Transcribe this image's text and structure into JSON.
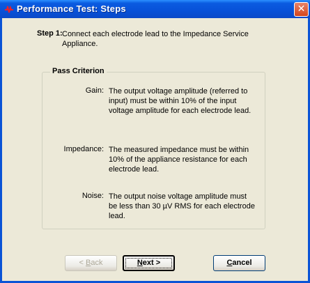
{
  "window": {
    "title": "Performance Test:  Steps"
  },
  "step": {
    "label": "Step 1:",
    "text": "Connect each electrode lead to the Impedance Service Appliance."
  },
  "pass_criterion": {
    "title": "Pass Criterion",
    "items": [
      {
        "label": "Gain:",
        "text": "The output voltage amplitude (referred to input) must be within 10% of the input voltage amplitude for each electrode lead."
      },
      {
        "label": "Impedance:",
        "text": "The measured impedance must be within 10% of the appliance resistance for each electrode lead."
      },
      {
        "label": "Noise:",
        "text": "The output noise voltage amplitude must be less than 30 µV RMS for each electrode lead."
      }
    ]
  },
  "buttons": {
    "back": {
      "pre": "< ",
      "accel": "B",
      "post": "ack",
      "enabled": false
    },
    "next": {
      "pre": "",
      "accel": "N",
      "post": "ext >",
      "enabled": true
    },
    "cancel": {
      "pre": "",
      "accel": "C",
      "post": "ancel",
      "enabled": true
    }
  },
  "colors": {
    "titlebar": "#0a53d6",
    "close": "#d2451d",
    "background": "#ece9d8"
  }
}
